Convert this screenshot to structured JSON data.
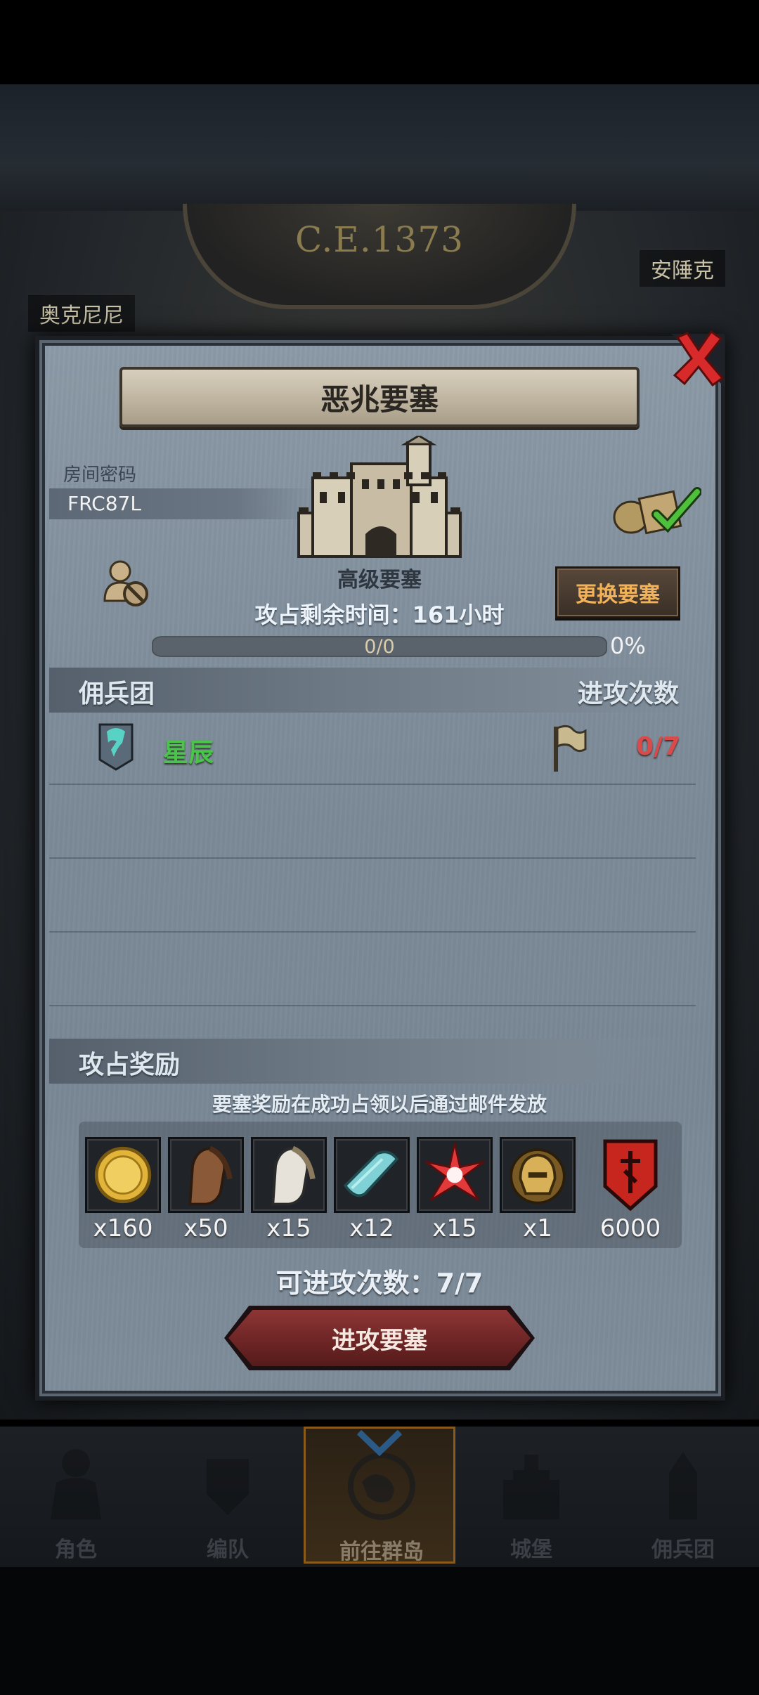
{
  "map": {
    "era": "C.E.1373",
    "city_left": "奥克尼尼",
    "city_right": "安陲克"
  },
  "dialog": {
    "title": "恶兆要塞",
    "room_label": "房间密码",
    "room_code": "FRC87L",
    "castle_name": "高级要塞",
    "timer_text": "攻占剩余时间：161小时",
    "change_button": "更换要塞",
    "progress_text": "0/0",
    "progress_percent_label": "0%",
    "progress_fraction": 0,
    "guild_header": "佣兵团",
    "attack_count_header": "进攻次数",
    "guilds": [
      {
        "name": "星辰",
        "attack_count": "0/7"
      }
    ],
    "reward_header": "攻占奖励",
    "reward_note": "要塞奖励在成功占领以后通过邮件发放",
    "rewards": [
      {
        "icon": "gold-coin-icon",
        "qty": "x160"
      },
      {
        "icon": "brown-horse-icon",
        "qty": "x50"
      },
      {
        "icon": "white-horse-icon",
        "qty": "x15"
      },
      {
        "icon": "cloth-scroll-icon",
        "qty": "x12"
      },
      {
        "icon": "red-star-burst-icon",
        "qty": "x15"
      },
      {
        "icon": "golden-helmet-icon",
        "qty": "x1"
      },
      {
        "icon": "red-banner-icon",
        "qty": "6000"
      }
    ],
    "attacks_left": "可进攻次数：7/7",
    "attack_button": "进攻要塞"
  },
  "nav": {
    "items": [
      {
        "label": "角色",
        "icon": "knight-icon"
      },
      {
        "label": "编队",
        "icon": "formation-icon"
      },
      {
        "label": "前往群岛",
        "icon": "globe-icon",
        "active": true
      },
      {
        "label": "城堡",
        "icon": "castle-icon"
      },
      {
        "label": "佣兵团",
        "icon": "mercenary-icon"
      }
    ]
  },
  "colors": {
    "guild_name": "#49c64a",
    "attack_count": "#d94b4b",
    "change_button_text": "#f2b25a",
    "attack_button": "#6b2424",
    "close_x": "#d82a2a"
  }
}
